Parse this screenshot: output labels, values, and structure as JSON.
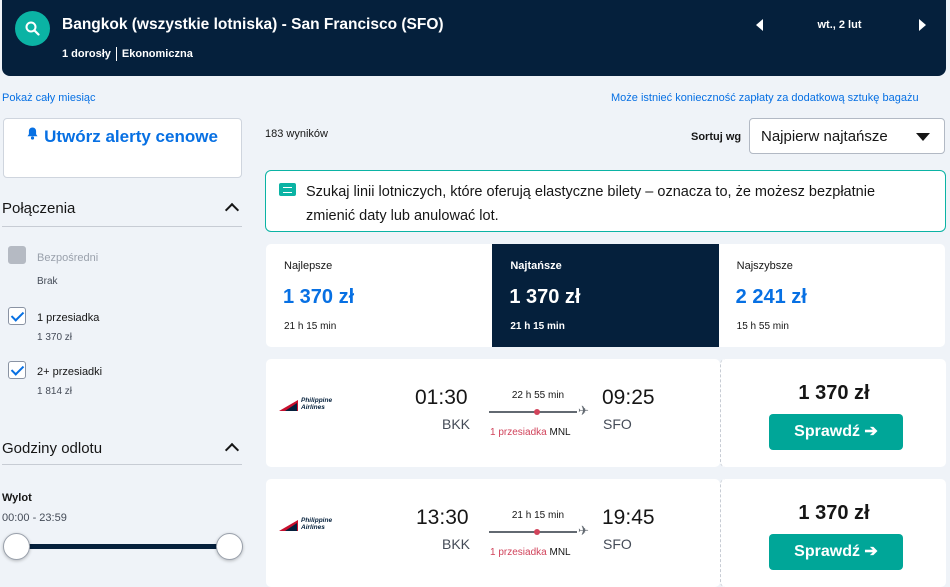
{
  "header": {
    "route": "Bangkok (wszystkie lotniska) - San Francisco (SFO)",
    "passengers": "1 dorosły",
    "cabin": "Ekonomiczna",
    "date": "wt., 2 lut"
  },
  "links": {
    "month": "Pokaż cały miesiąc",
    "baggage": "Może istnieć konieczność zapłaty za dodatkową sztukę bagażu"
  },
  "sidebar": {
    "alert_label": "Utwórz alerty cenowe",
    "connections_title": "Połączenia",
    "options": [
      {
        "label": "Bezpośredni",
        "price": "Brak",
        "checked": false,
        "disabled": true
      },
      {
        "label": "1 przesiadka",
        "price": "1 370 zł",
        "checked": true,
        "disabled": false
      },
      {
        "label": "2+ przesiadki",
        "price": "1 814 zł",
        "checked": true,
        "disabled": false
      }
    ],
    "times_title": "Godziny odlotu",
    "departure_label": "Wylot",
    "departure_range": "00:00 - 23:59"
  },
  "main": {
    "results_count": "183 wyników",
    "sort_label": "Sortuj wg",
    "sort_value": "Najpierw najtańsze",
    "info_text": "Szukaj linii lotniczych, które oferują elastyczne bilety – oznacza to, że możesz bezpłatnie zmienić daty lub anulować lot.",
    "tabs": [
      {
        "name": "Najlepsze",
        "price": "1 370 zł",
        "duration": "21 h 15 min"
      },
      {
        "name": "Najtańsze",
        "price": "1 370 zł",
        "duration": "21 h 15 min"
      },
      {
        "name": "Najszybsze",
        "price": "2 241 zł",
        "duration": "15 h 55 min"
      }
    ],
    "flights": [
      {
        "airline": "Philippine Airlines",
        "dep_time": "01:30",
        "dep_code": "BKK",
        "arr_time": "09:25",
        "arr_code": "SFO",
        "duration": "22 h 55 min",
        "stops": "1 przesiadka",
        "via": "MNL",
        "price": "1 370 zł",
        "button": "Sprawdź"
      },
      {
        "airline": "Philippine Airlines",
        "dep_time": "13:30",
        "dep_code": "BKK",
        "arr_time": "19:45",
        "arr_code": "SFO",
        "duration": "21 h 15 min",
        "stops": "1 przesiadka",
        "via": "MNL",
        "price": "1 370 zł",
        "button": "Sprawdź"
      }
    ]
  },
  "colors": {
    "navy": "#05203c",
    "teal": "#00a698",
    "blue": "#0770e3",
    "stops_red": "#d1435b"
  }
}
